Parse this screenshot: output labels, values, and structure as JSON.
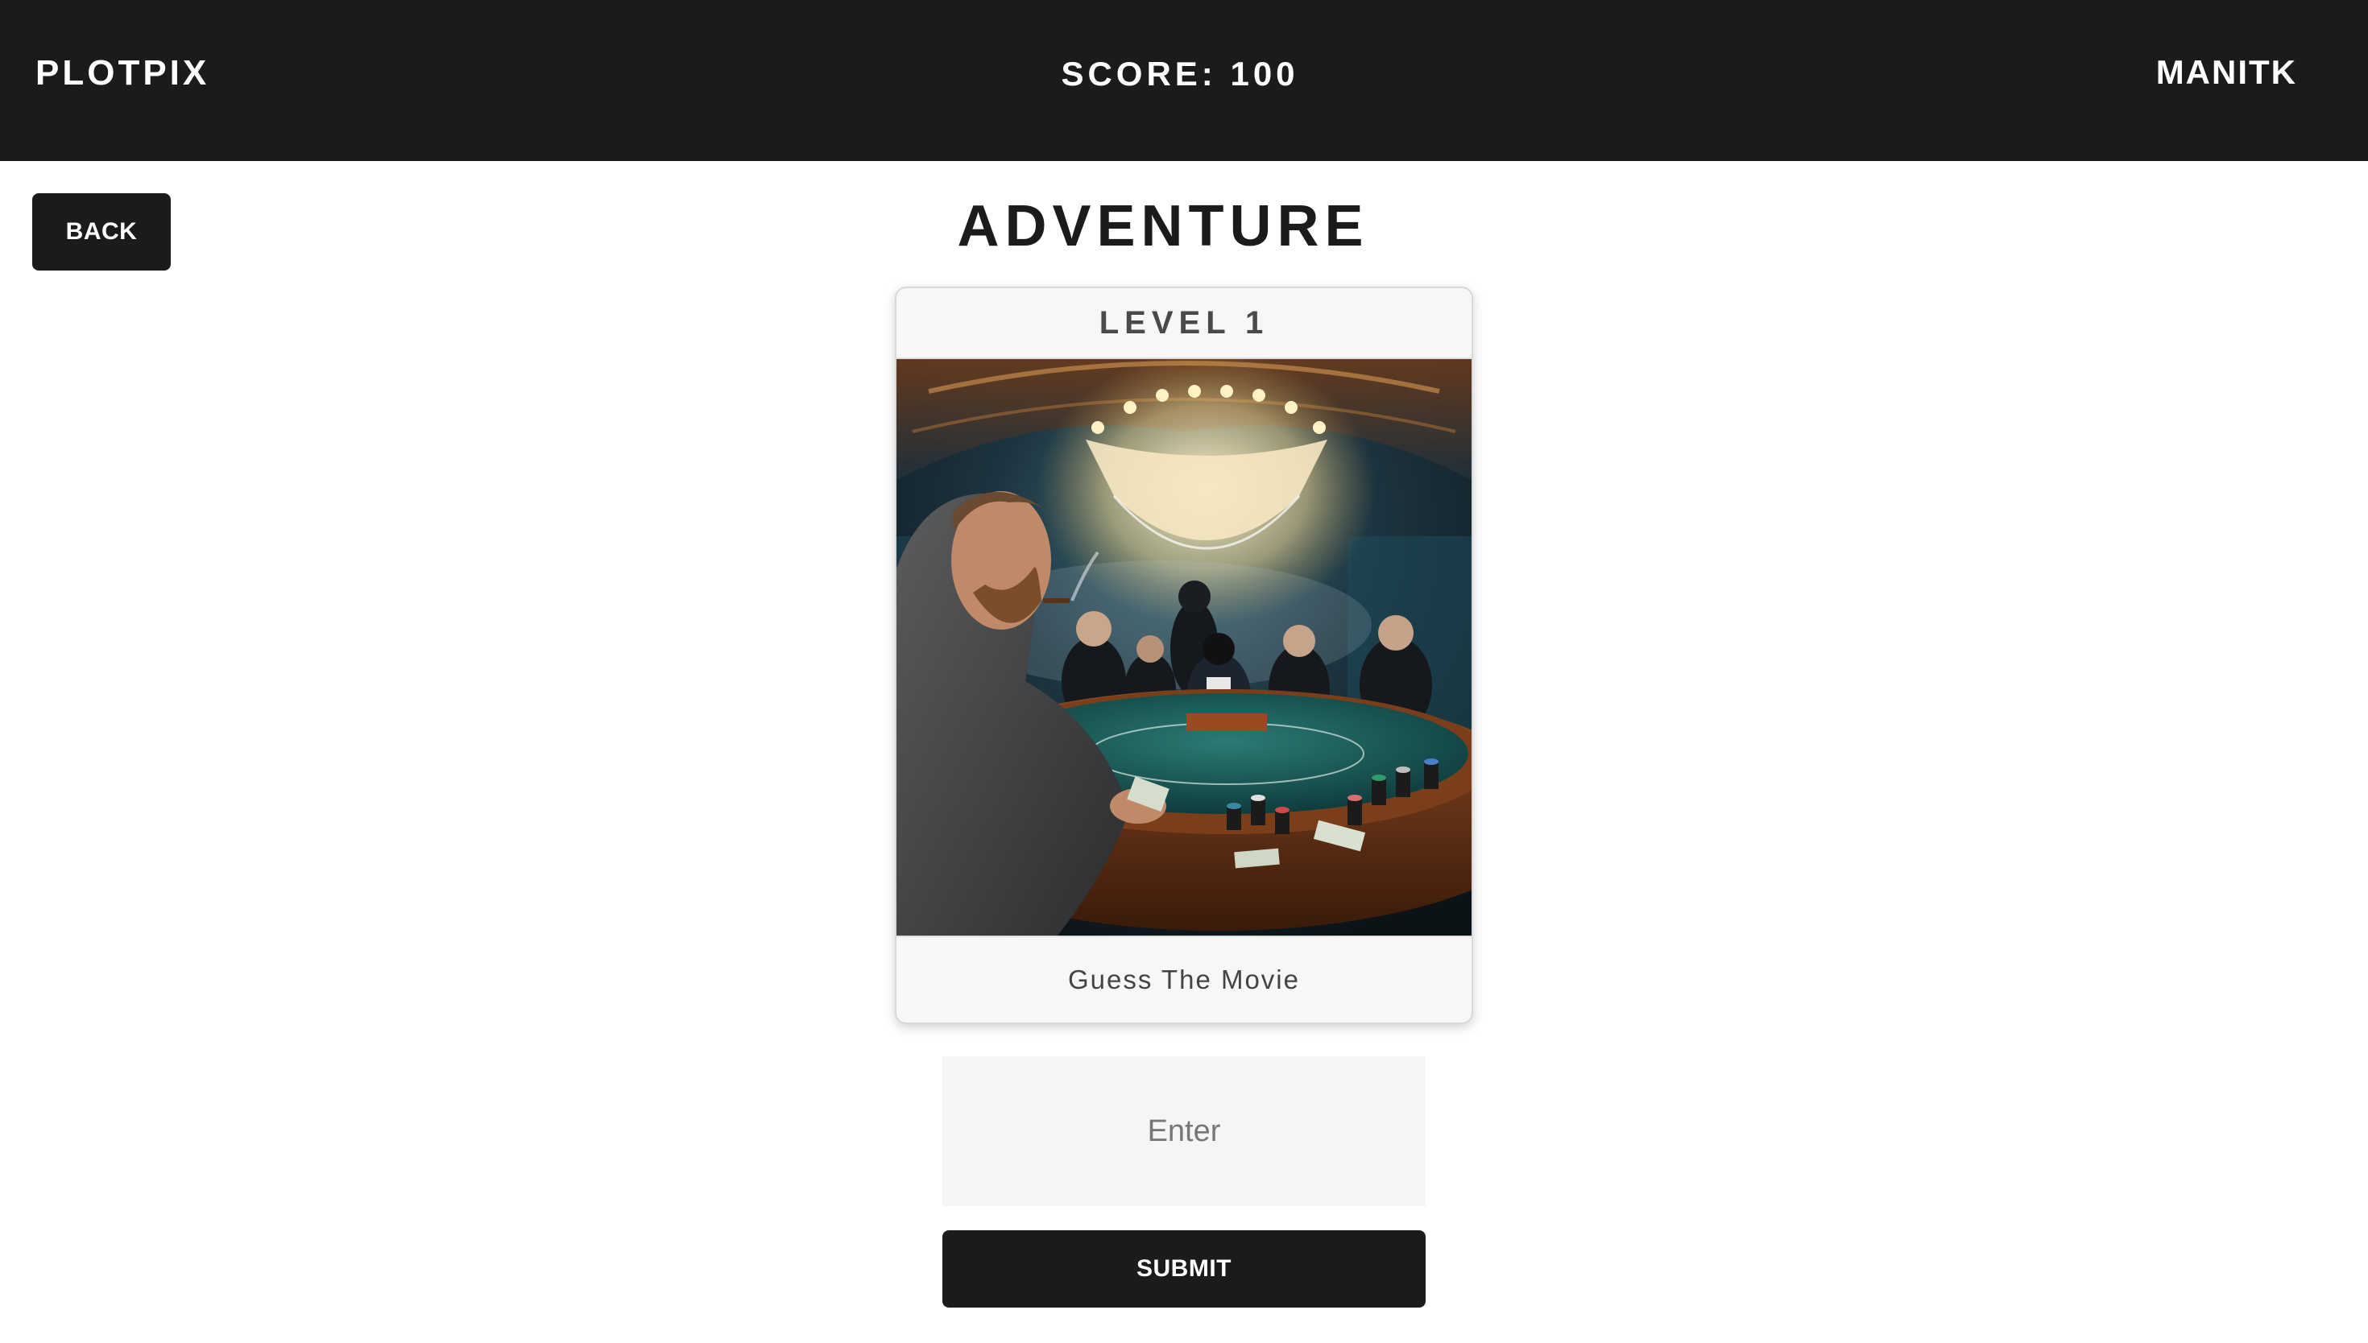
{
  "header": {
    "brand": "PLOTPIX",
    "score": "SCORE: 100",
    "username": "MANITK"
  },
  "back_button": {
    "label": "BACK"
  },
  "mode": {
    "title": "ADVENTURE"
  },
  "level_card": {
    "level_label": "LEVEL 1",
    "prompt": "Guess The Movie"
  },
  "answer": {
    "placeholder": "Enter",
    "value": ""
  },
  "submit_button": {
    "label": "SUBMIT"
  },
  "colors": {
    "header_bg": "#1b1b1b",
    "button_bg": "#1b1b1b",
    "input_bg": "#f4f5f7",
    "card_bg": "#f7f7f8"
  }
}
